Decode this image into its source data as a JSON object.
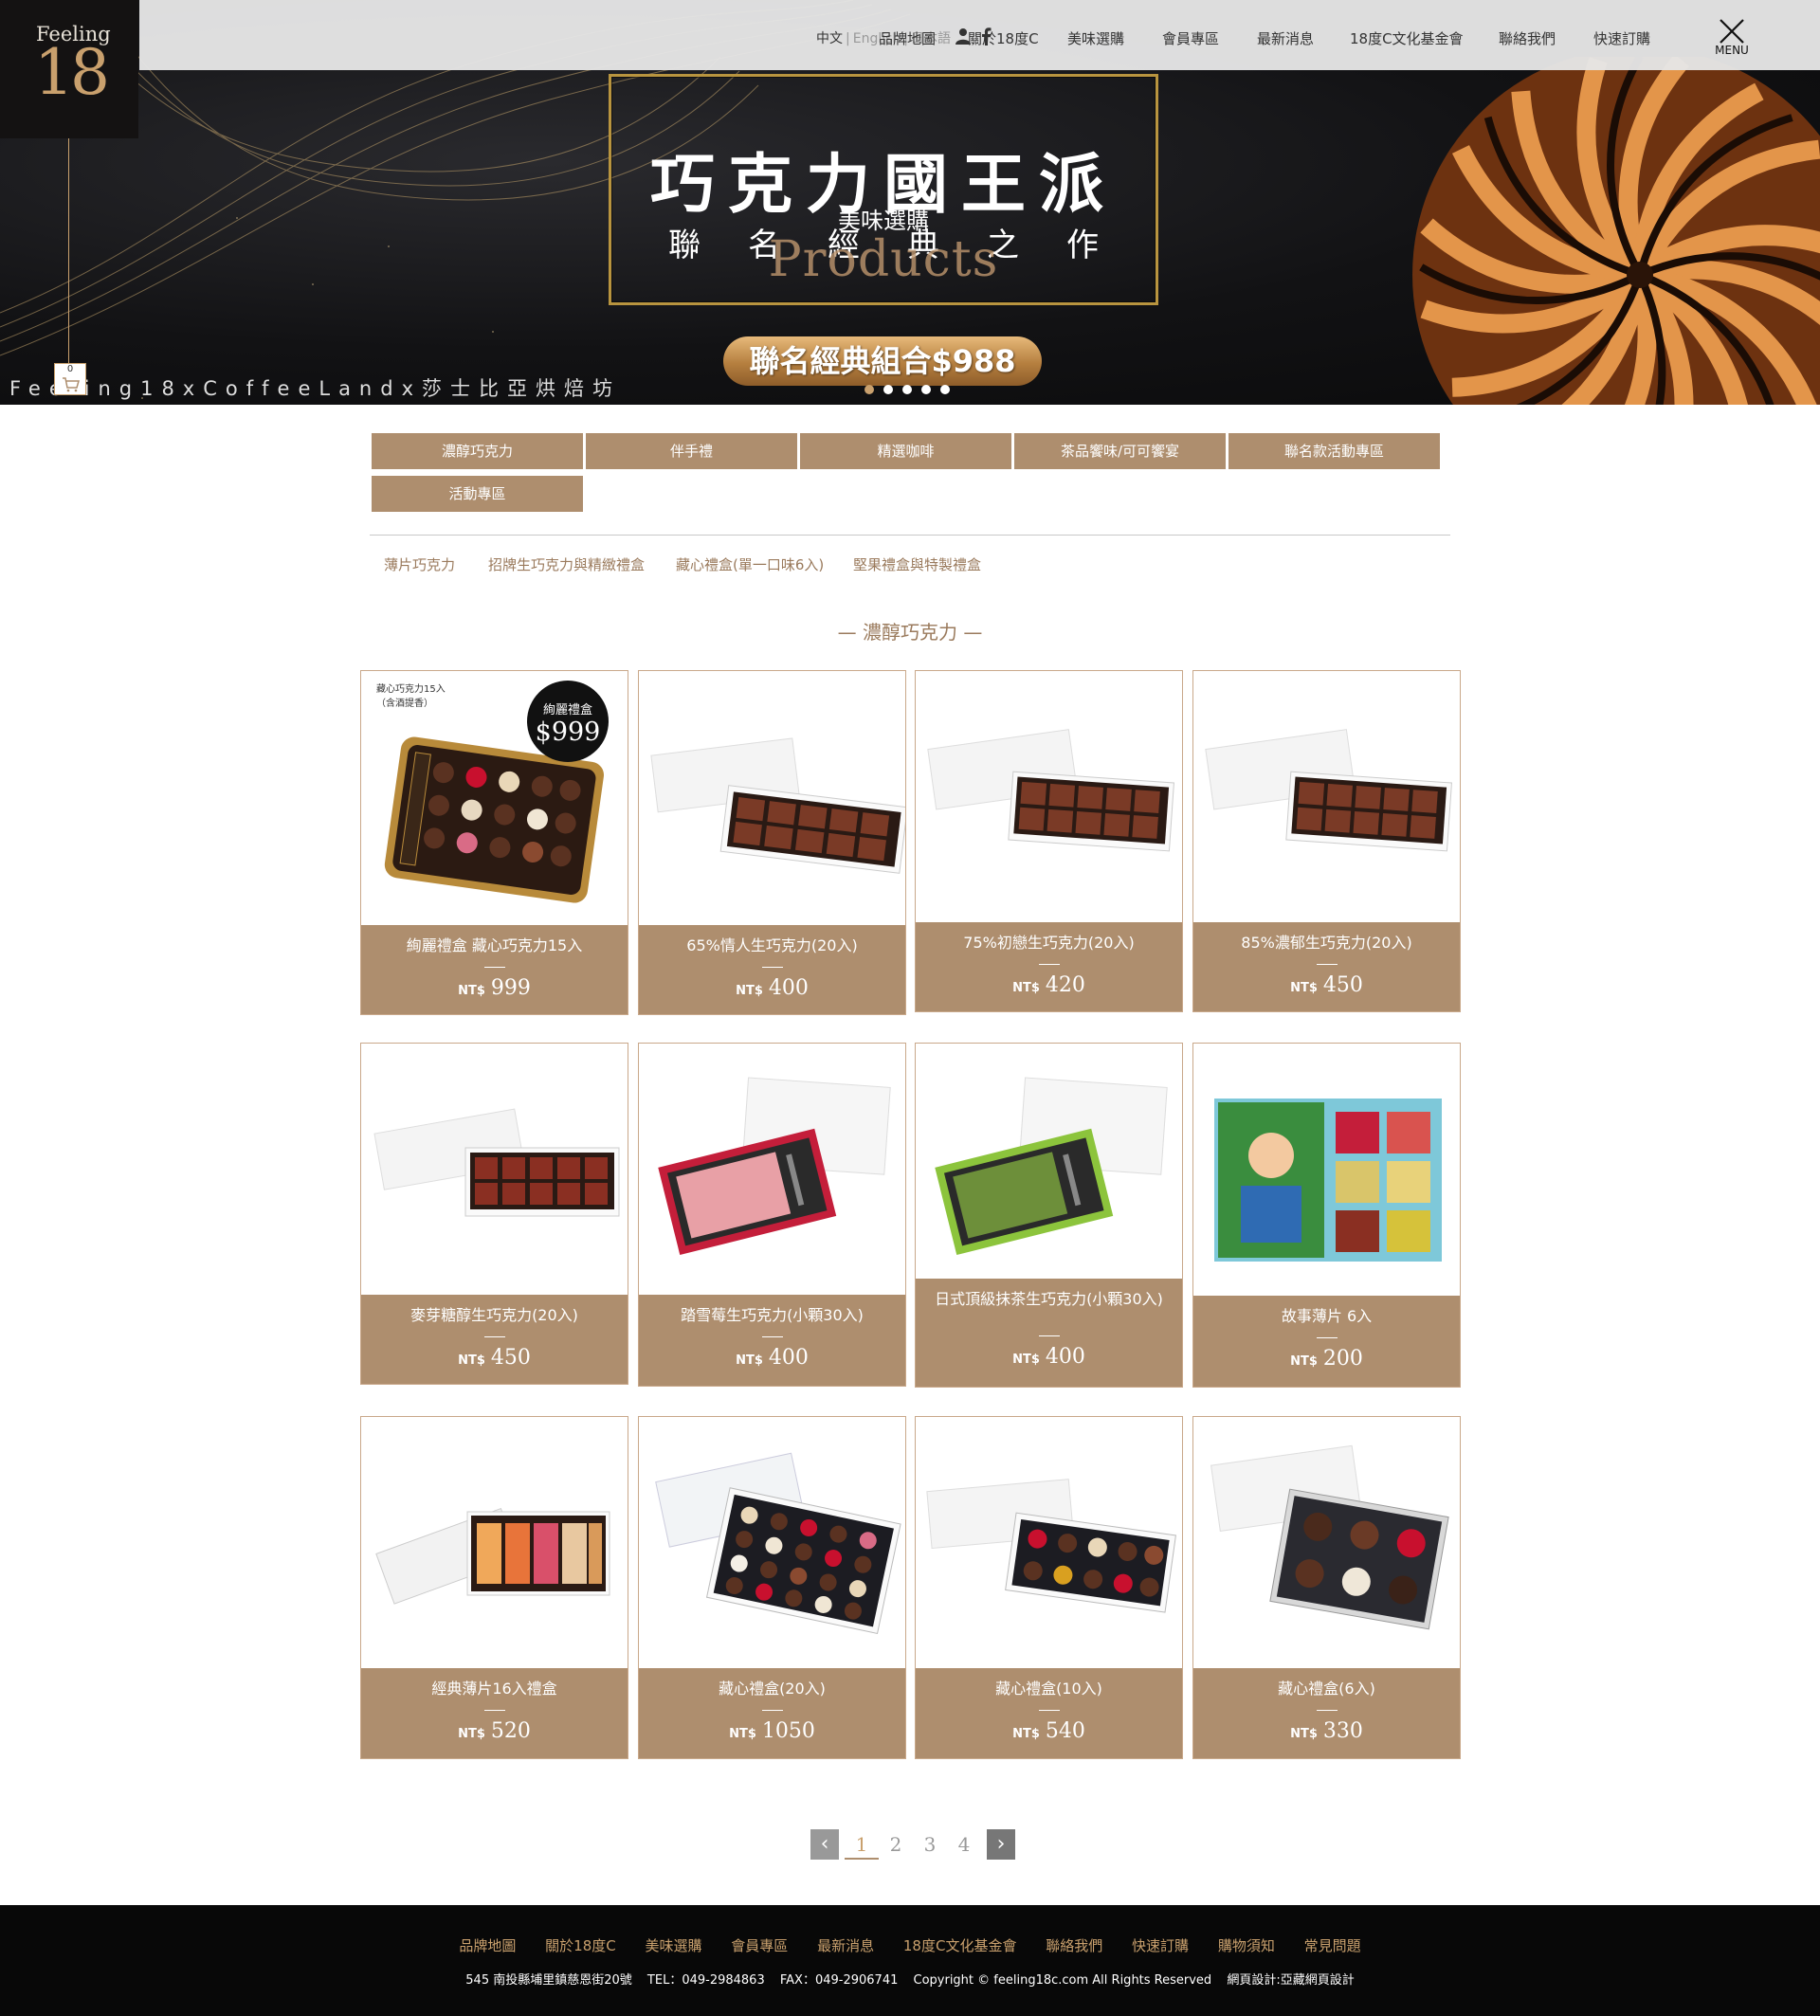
{
  "logo": {
    "text": "Feeling",
    "number": "18"
  },
  "cart": {
    "count": "0"
  },
  "topbar": {
    "lang_current": "中文",
    "lang_en": "English",
    "lang_ja": "日本語",
    "nav": [
      "品牌地圖",
      "關於18度C",
      "美味選購",
      "會員專區",
      "最新消息",
      "18度C文化基金會",
      "聯絡我們",
      "快速訂購"
    ],
    "menu_label": "MENU"
  },
  "hero": {
    "title": "巧克力國王派",
    "subtitle_chars": [
      "聯",
      "名",
      "經",
      "典",
      "之",
      "作"
    ],
    "ghost_zh": "美味選購",
    "ghost_en": "Products",
    "pill": "聯名經典組合$988",
    "tagline": "Feeling18xCoffeeLandx莎士比亞烘焙坊",
    "slides": 5,
    "active_slide": 1
  },
  "tabs": [
    "濃醇巧克力",
    "伴手禮",
    "精選咖啡",
    "茶品饗味/可可饗宴",
    "聯名款活動專區",
    "活動專區"
  ],
  "subtabs": [
    "薄片巧克力",
    "招牌生巧克力與精緻禮盒",
    "藏心禮盒(單一口味6入)",
    "堅果禮盒與特製禮盒"
  ],
  "section_title": "— 濃醇巧克力 —",
  "currency": "NT$",
  "products": [
    {
      "name": "絢麗禮盒 藏心巧克力15入",
      "price": "999",
      "badge_title": "絢麗禮盒",
      "badge_price": "$999",
      "note_1": "藏心巧克力15入",
      "note_2": "（含酒提香）"
    },
    {
      "name": "65%情人生巧克力(20入)",
      "price": "400"
    },
    {
      "name": "75%初戀生巧克力(20入)",
      "price": "420"
    },
    {
      "name": "85%濃郁生巧克力(20入)",
      "price": "450"
    },
    {
      "name": "麥芽糖醇生巧克力(20入)",
      "price": "450"
    },
    {
      "name": "踏雪莓生巧克力(小顆30入)",
      "price": "400"
    },
    {
      "name": "日式頂級抹茶生巧克力(小顆30入)",
      "price": "400"
    },
    {
      "name": "故事薄片 6入",
      "price": "200"
    },
    {
      "name": "經典薄片16入禮盒",
      "price": "520"
    },
    {
      "name": "藏心禮盒(20入)",
      "price": "1050"
    },
    {
      "name": "藏心禮盒(10入)",
      "price": "540"
    },
    {
      "name": "藏心禮盒(6入)",
      "price": "330"
    }
  ],
  "pagination": {
    "prev": "‹",
    "next": "›",
    "pages": [
      "1",
      "2",
      "3",
      "4"
    ],
    "current": "1"
  },
  "footer": {
    "nav": [
      "品牌地圖",
      "關於18度C",
      "美味選購",
      "會員專區",
      "最新消息",
      "18度C文化基金會",
      "聯絡我們",
      "快速訂購",
      "購物須知",
      "常見問題"
    ],
    "address": "545 南投縣埔里鎮慈恩街20號",
    "tel": "TEL：049-2984863",
    "fax": "FAX：049-2906741",
    "copyright": "Copyright © feeling18c.com All Rights Reserved",
    "design": "網頁設計:亞藏網頁設計"
  },
  "colors": {
    "brand": "#ae8e6e",
    "gold": "#c9a06d",
    "dark": "#141212"
  }
}
